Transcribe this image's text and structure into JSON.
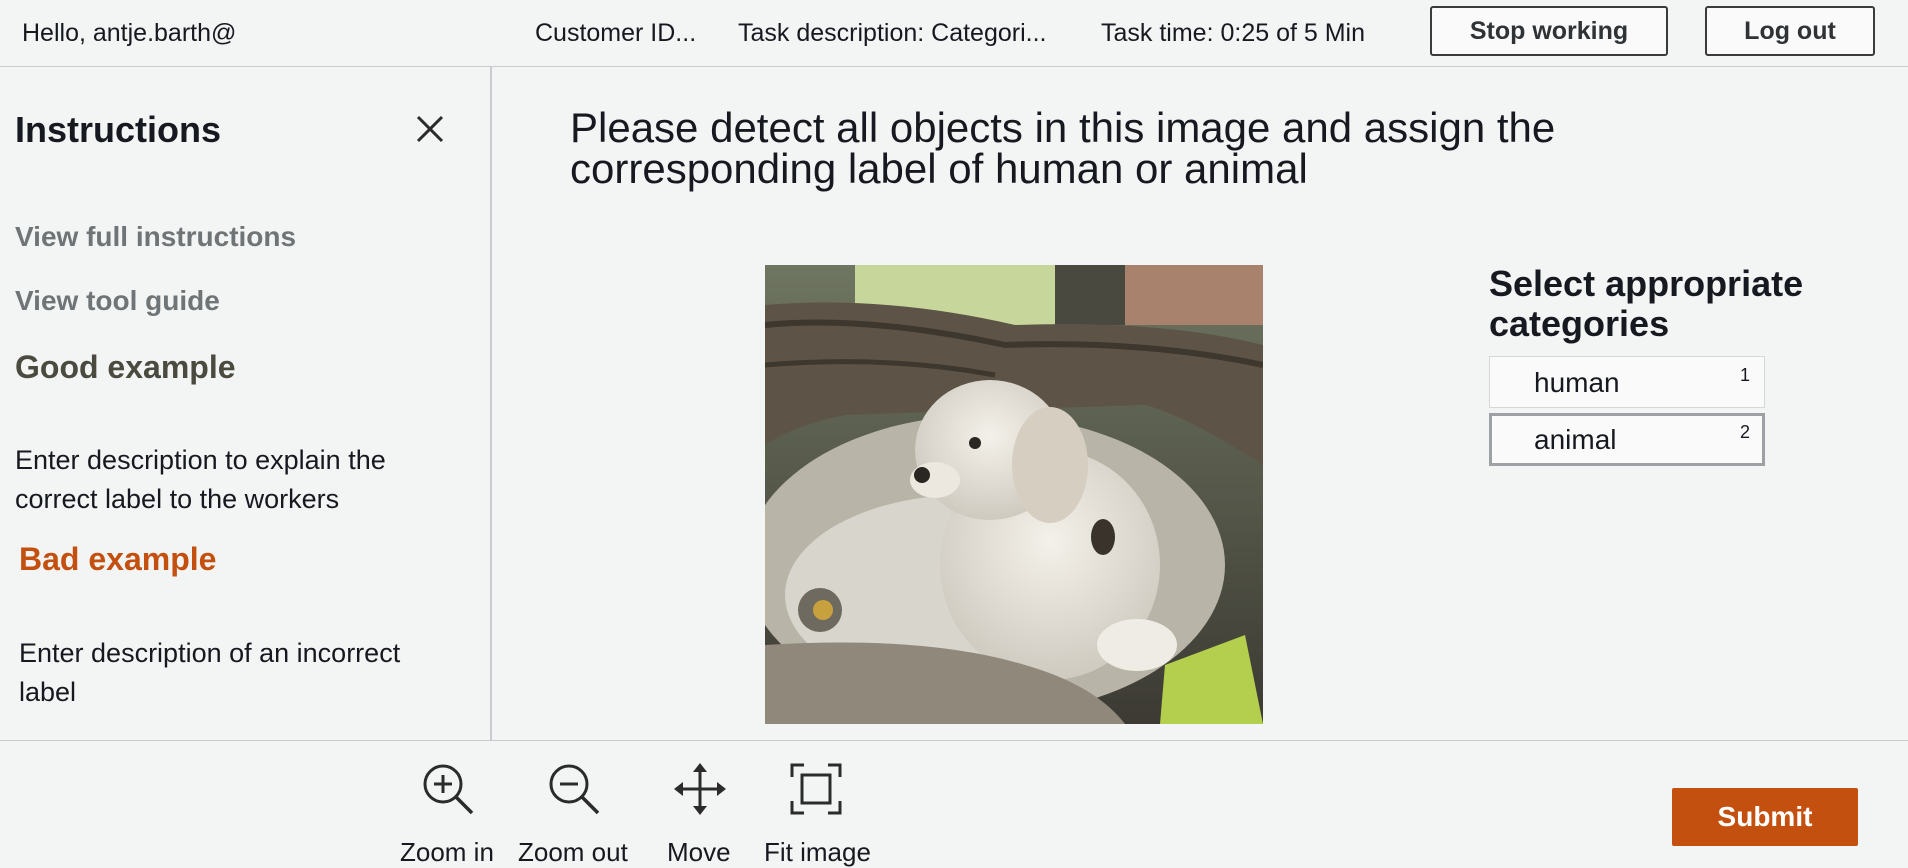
{
  "header": {
    "greeting": "Hello, antje.barth@",
    "customer_id": "Customer ID...",
    "task_description": "Task description: Categori...",
    "task_time": "Task time: 0:25 of 5 Min",
    "stop_label": "Stop working",
    "logout_label": "Log out"
  },
  "sidebar": {
    "title": "Instructions",
    "close_icon": "close-icon",
    "links": [
      "View full instructions",
      "View tool guide"
    ],
    "good_example": {
      "heading": "Good example",
      "text": "Enter description to explain the correct label to the workers",
      "color": "#4a4a3f"
    },
    "bad_example": {
      "heading": "Bad example",
      "text": "Enter description of an incorrect label",
      "color": "#c4500f"
    }
  },
  "main": {
    "question": "Please detect all objects in this image and assign the corresponding label of human or animal",
    "image_alt": "puppy in dog bed"
  },
  "categories": {
    "heading": "Select appropriate categories",
    "items": [
      {
        "label": "human",
        "key": "1",
        "selected": false
      },
      {
        "label": "animal",
        "key": "2",
        "selected": true
      }
    ]
  },
  "toolbar": {
    "zoom_in": "Zoom in",
    "zoom_out": "Zoom out",
    "move": "Move",
    "fit_image": "Fit image",
    "icons": [
      "zoom-in-icon",
      "zoom-out-icon",
      "move-icon",
      "fit-image-icon"
    ]
  },
  "submit_label": "Submit",
  "colors": {
    "accent": "#c4500f",
    "background": "#f3f4f4"
  }
}
